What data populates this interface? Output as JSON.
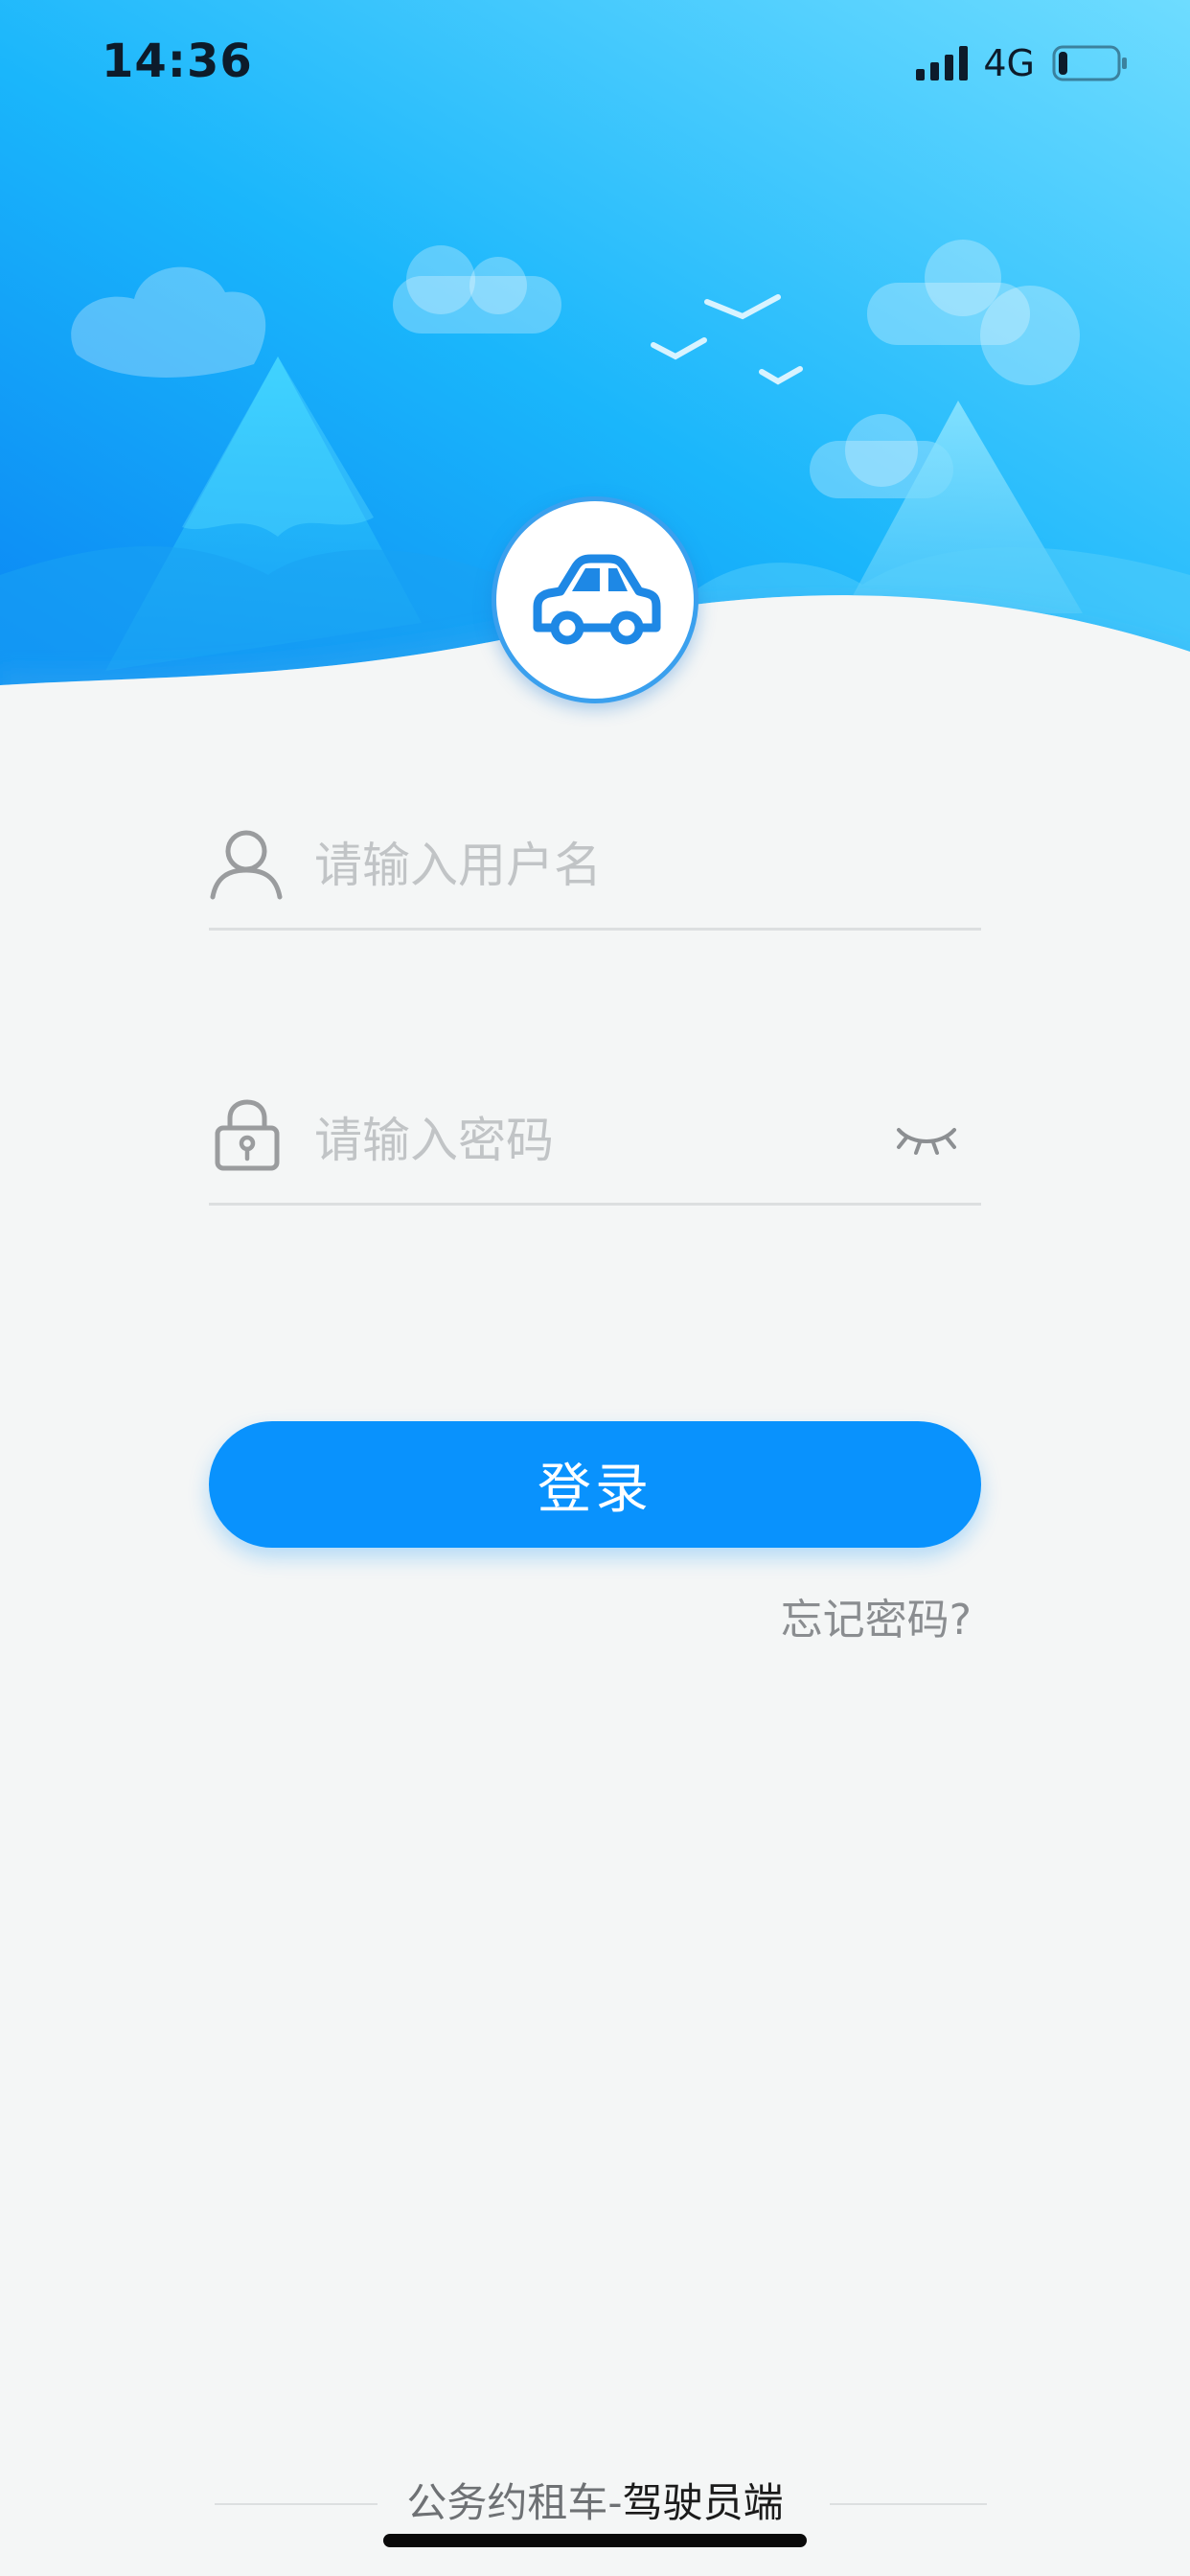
{
  "status_bar": {
    "time": "14:36",
    "network": "4G",
    "battery_level": 0.15
  },
  "login_form": {
    "username_placeholder": "请输入用户名",
    "password_placeholder": "请输入密码",
    "login_label": "登录",
    "forgot_label": "忘记密码?"
  },
  "footer": {
    "app_name": "公务约租车-",
    "subtitle": "驾驶员端"
  },
  "colors": {
    "primary": "#0992FD",
    "sky_top": "#0A8BF5",
    "sky_light": "#66D8FF",
    "background": "#F4F6F6"
  }
}
